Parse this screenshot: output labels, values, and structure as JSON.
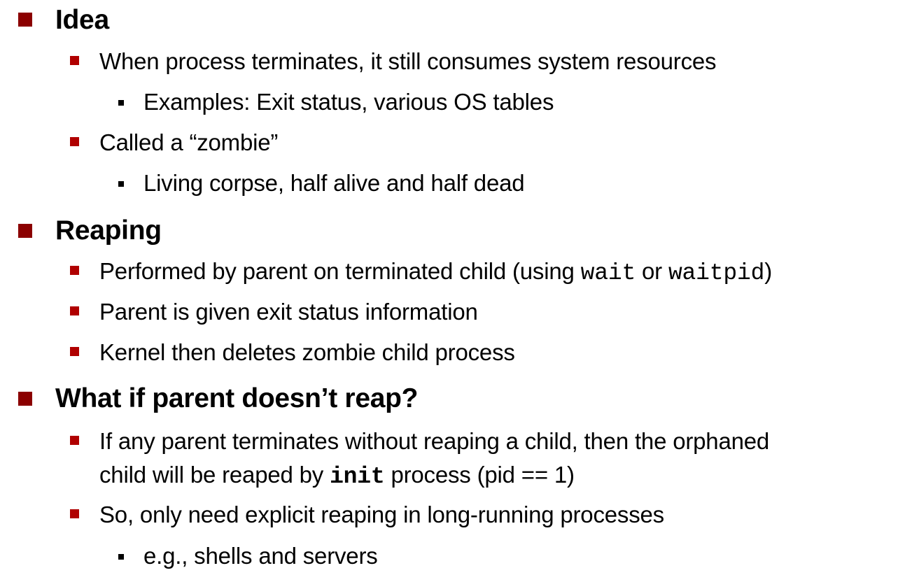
{
  "sections": [
    {
      "heading": "Idea",
      "items": [
        {
          "text": "When process terminates, it still consumes system resources",
          "subitems": [
            "Examples: Exit status, various OS tables"
          ]
        },
        {
          "text": "Called a “zombie”",
          "subitems": [
            "Living corpse, half alive and half dead"
          ]
        }
      ]
    },
    {
      "heading": "Reaping",
      "items": [
        {
          "text_before": "Performed by parent on terminated child (using ",
          "code1": "wait",
          "text_middle": " or ",
          "code2": "waitpid",
          "text_after": ")"
        },
        {
          "text": "Parent is given exit status information"
        },
        {
          "text": "Kernel then deletes zombie child process"
        }
      ]
    },
    {
      "heading": "What if parent doesn’t reap?",
      "items": [
        {
          "line1": "If any parent terminates without reaping a child, then the orphaned",
          "line2_before": "child will be reaped by ",
          "line2_code": "init",
          "line2_after": " process (pid == 1)"
        },
        {
          "text": "So, only need explicit reaping in long-running processes",
          "subitems": [
            "e.g., shells and servers"
          ]
        }
      ]
    }
  ]
}
